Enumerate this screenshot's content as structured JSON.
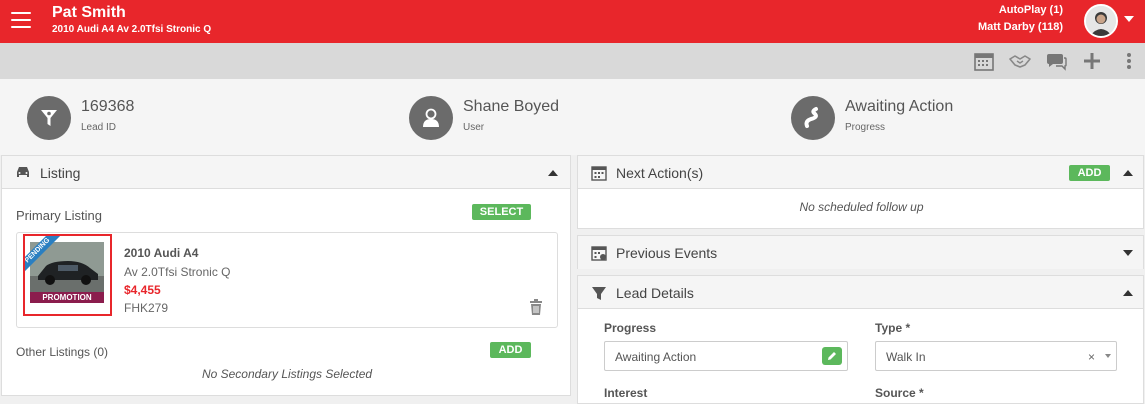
{
  "header": {
    "customer_name": "Pat Smith",
    "vehicle": "2010 Audi A4 Av 2.0Tfsi Stronic Q",
    "autoplay": "AutoPlay (1)",
    "user_count": "Matt Darby (118)",
    "bg_color": "#e8262b"
  },
  "toolbar": {
    "icons": [
      "calendar-icon",
      "handshake-icon",
      "chat-icon",
      "plus-icon",
      "more-vertical-icon"
    ]
  },
  "summary": {
    "lead_id": {
      "value": "169368",
      "label": "Lead ID"
    },
    "user": {
      "value": "Shane Boyed",
      "label": "User"
    },
    "progress": {
      "value": "Awaiting Action",
      "label": "Progress"
    }
  },
  "listing": {
    "title": "Listing",
    "primary_label": "Primary Listing",
    "select_label": "SELECT",
    "card": {
      "badge": "PENDING",
      "promo": "PROMOTION",
      "title": "2010 Audi A4",
      "subtitle": "Av 2.0Tfsi Stronic Q",
      "price": "$4,455",
      "stock": "FHK279"
    },
    "other_label": "Other Listings (0)",
    "add_label": "ADD",
    "none_note": "No Secondary Listings Selected"
  },
  "next_actions": {
    "title": "Next Action(s)",
    "add_label": "ADD",
    "note": "No scheduled follow up"
  },
  "previous_events": {
    "title": "Previous Events"
  },
  "lead_details": {
    "title": "Lead Details",
    "progress_label": "Progress",
    "progress_value": "Awaiting Action",
    "type_label": "Type *",
    "type_value": "Walk In",
    "interest_label": "Interest",
    "source_label": "Source *"
  },
  "colors": {
    "accent_red": "#e8262b",
    "green": "#5cb85c",
    "promo": "#8b1d4d",
    "pending": "#2a7fc1"
  }
}
